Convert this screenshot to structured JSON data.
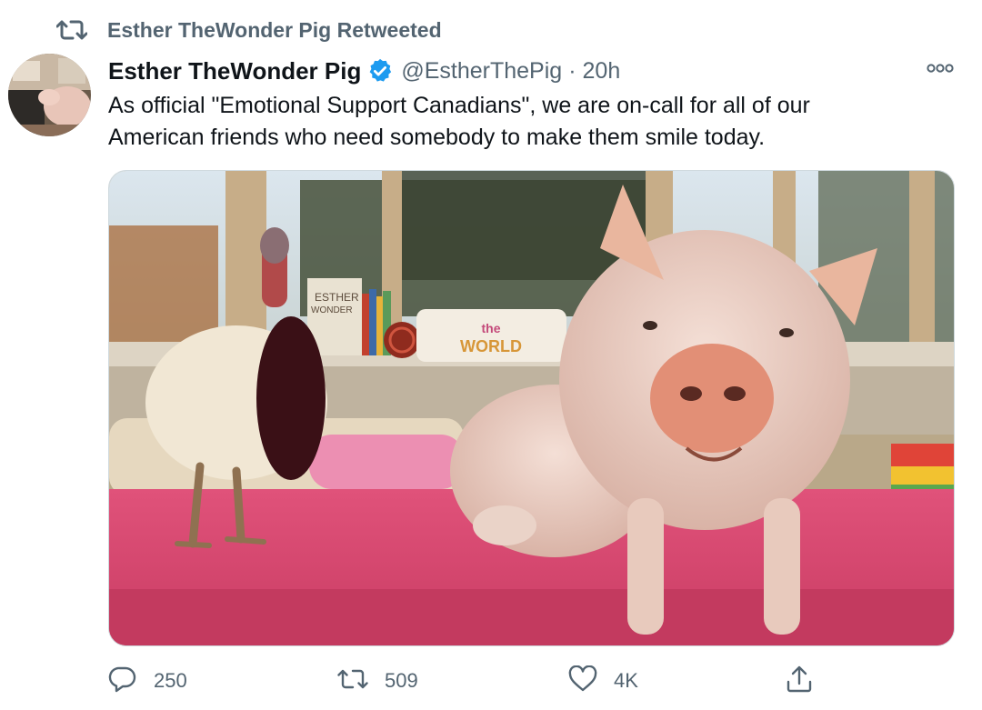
{
  "retweet_banner": {
    "label": "Esther TheWonder Pig Retweeted",
    "icon": "retweet-icon"
  },
  "author": {
    "display_name": "Esther TheWonder Pig",
    "verified": true,
    "handle": "@EstherThePig",
    "separator": "·",
    "time": "20h"
  },
  "tweet": {
    "text_line1": "As official \"Emotional Support Canadians\", we are on-call for all of our",
    "text_line2": "American friends who need somebody to make them smile today."
  },
  "media": {
    "description_icon": "photo",
    "book_text": "ESTHER",
    "book_subtext": "WONDER",
    "pillow_line1": "the",
    "pillow_line2": "WORLD"
  },
  "actions": {
    "reply_count": "250",
    "retweet_count": "509",
    "like_count": "4K",
    "share_icon": "share-icon"
  },
  "colors": {
    "text_primary": "#0f1419",
    "text_secondary": "#536471",
    "verified_blue": "#1d9bf0",
    "border": "#cfd9de"
  }
}
